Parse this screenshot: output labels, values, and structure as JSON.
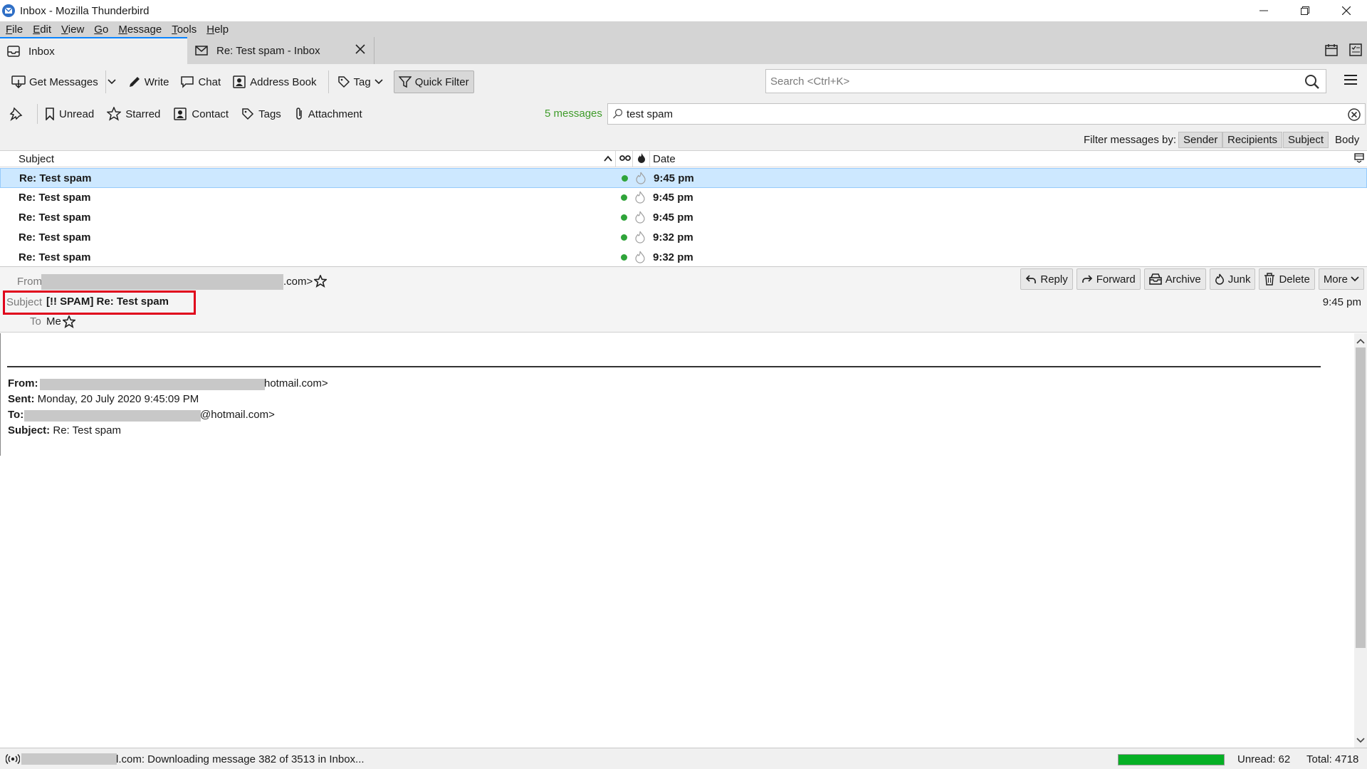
{
  "window": {
    "title": "Inbox - Mozilla Thunderbird"
  },
  "menu": [
    "File",
    "Edit",
    "View",
    "Go",
    "Message",
    "Tools",
    "Help"
  ],
  "tabs": [
    {
      "label": "Inbox",
      "icon": "inbox-icon"
    },
    {
      "label": "Re: Test spam - Inbox",
      "icon": "envelope-icon"
    }
  ],
  "toolbar": {
    "get_messages": "Get Messages",
    "write": "Write",
    "chat": "Chat",
    "address_book": "Address Book",
    "tag": "Tag",
    "quick_filter": "Quick Filter",
    "search_placeholder": "Search <Ctrl+K>"
  },
  "quick_filter": {
    "unread": "Unread",
    "starred": "Starred",
    "contact": "Contact",
    "tags": "Tags",
    "attachment": "Attachment",
    "message_count": "5 messages",
    "search_value": "test spam",
    "filter_by_label": "Filter messages by:",
    "filter_options": [
      {
        "label": "Sender",
        "active": true
      },
      {
        "label": "Recipients",
        "active": true
      },
      {
        "label": "Subject",
        "active": true
      },
      {
        "label": "Body",
        "active": false
      }
    ]
  },
  "thread_list": {
    "columns": {
      "subject": "Subject",
      "date": "Date"
    },
    "rows": [
      {
        "subject": "Re: Test spam",
        "date": "9:45 pm",
        "selected": true
      },
      {
        "subject": "Re: Test spam",
        "date": "9:45 pm",
        "selected": false
      },
      {
        "subject": "Re: Test spam",
        "date": "9:45 pm",
        "selected": false
      },
      {
        "subject": "Re: Test spam",
        "date": "9:32 pm",
        "selected": false
      },
      {
        "subject": "Re: Test spam",
        "date": "9:32 pm",
        "selected": false
      }
    ]
  },
  "message_header": {
    "from_label": "From",
    "from_tail": ".com>",
    "subject_label": "Subject",
    "subject": "[!! SPAM] Re: Test spam",
    "to_label": "To",
    "to": "Me",
    "time": "9:45 pm",
    "actions": {
      "reply": "Reply",
      "forward": "Forward",
      "archive": "Archive",
      "junk": "Junk",
      "delete": "Delete",
      "more": "More"
    }
  },
  "message_body": {
    "from_label": "From:",
    "from_tail": "hotmail.com>",
    "sent_label": "Sent:",
    "sent_value": "Monday, 20 July 2020 9:45:09 PM",
    "to_label": "To:",
    "to_tail": "@hotmail.com>",
    "subject_label": "Subject:",
    "subject_value": "Re: Test spam"
  },
  "status": {
    "text_tail": "l.com: Downloading message 382 of 3513 in Inbox...",
    "progress": 1.0,
    "unread": "Unread: 62",
    "total": "Total: 4718"
  },
  "colors": {
    "accent": "#0a84ff",
    "selection": "#cde8ff",
    "highlight_box": "#e0001b",
    "count_green": "#3f9c2a",
    "progress_green": "#06b025"
  }
}
